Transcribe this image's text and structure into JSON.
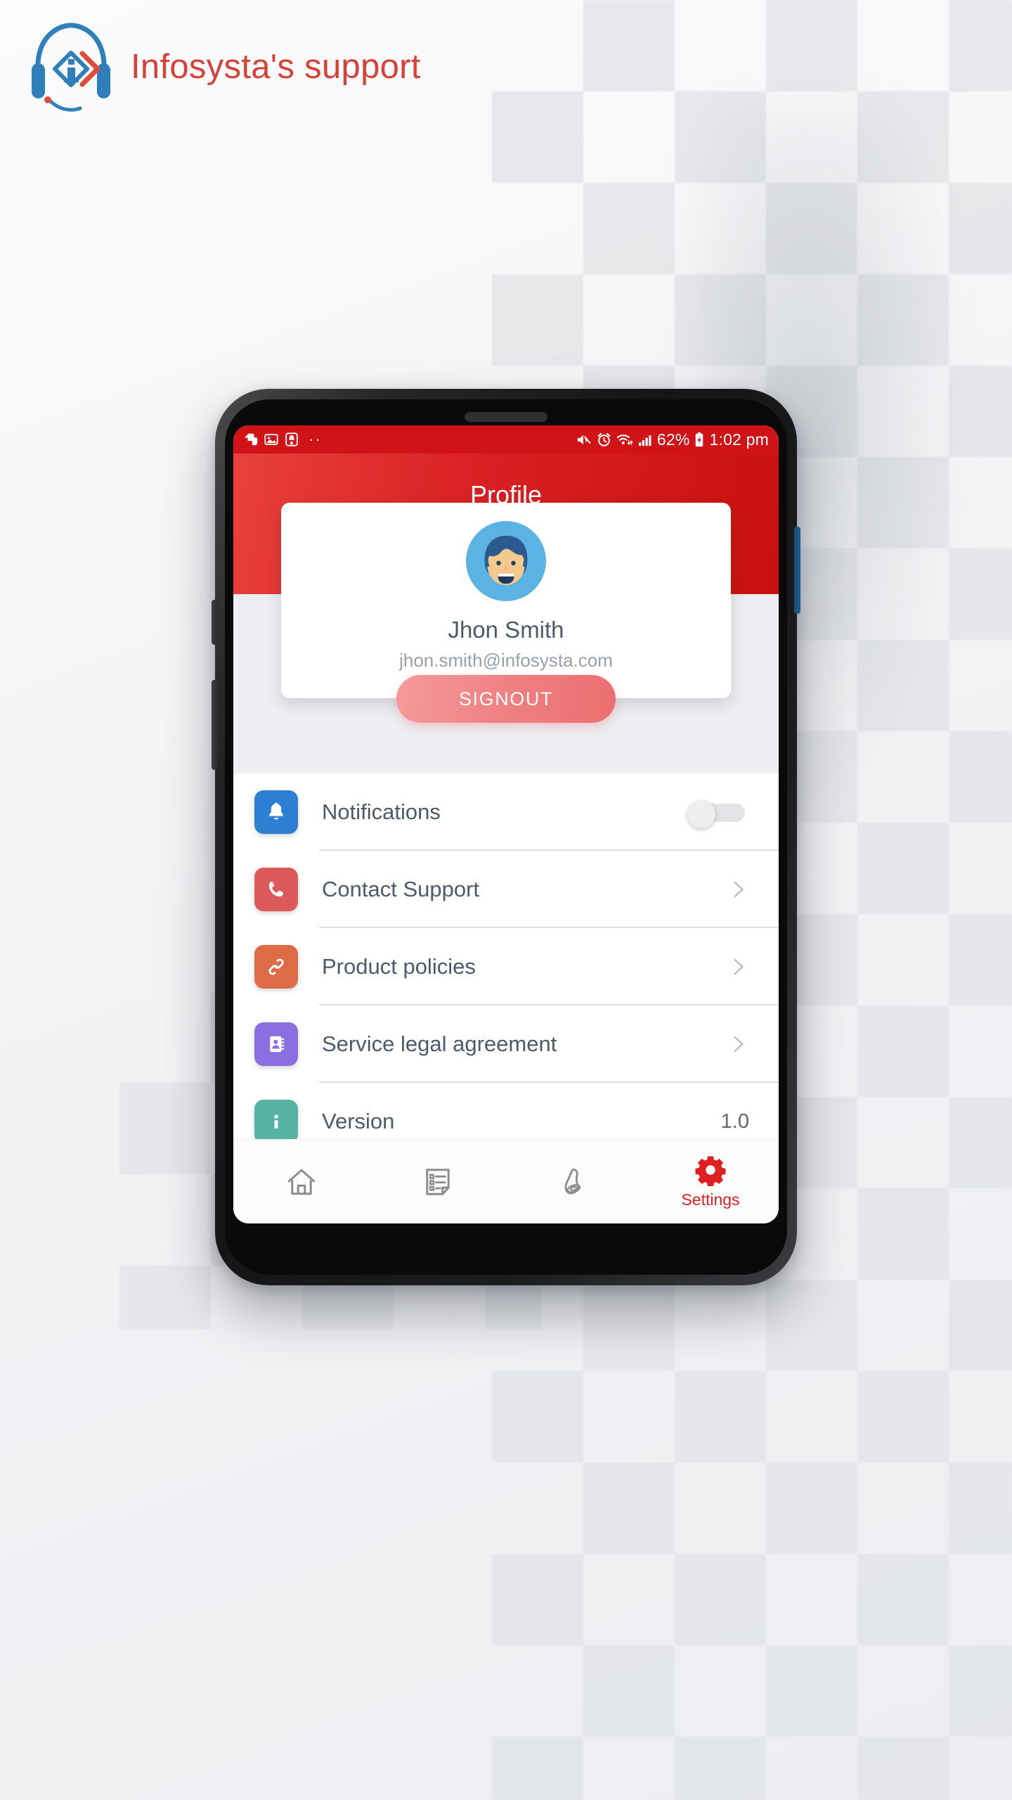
{
  "brand": {
    "name": "Infosysta's support",
    "logo_icon": "infosysta-headset-logo",
    "text_color": "#d84137",
    "mark_blue": "#2e7fba",
    "mark_red": "#e14b3c"
  },
  "phone": {
    "frame": "android-phone-mockup",
    "buttons": {
      "volume_up": "volume-up-button",
      "volume_down": "volume-down-button",
      "power": "power-button"
    }
  },
  "statusbar": {
    "left_icons": [
      "evernote-icon",
      "gallery-image-icon",
      "alarm-notification-icon"
    ],
    "overflow_dots": "··",
    "right_icons": [
      "mute-icon",
      "alarm-icon",
      "wifi-icon",
      "signal-bars-icon",
      "charging-battery-icon"
    ],
    "battery_percent": "62%",
    "clock": "1:02 pm",
    "background": "#cf1317"
  },
  "appbar": {
    "title": "Profile",
    "background_start": "#e8413c",
    "background_end": "#c8120f"
  },
  "profile": {
    "avatar_icon": "user-avatar-illustration",
    "name": "Jhon Smith",
    "email": "jhon.smith@infosysta.com",
    "signout_label": "SIGNOUT",
    "signout_color": "#ec6e70"
  },
  "settings": {
    "rows": [
      {
        "label": "Notifications",
        "icon": "bell-icon",
        "icon_color": "#2d7fd3",
        "control": "toggle",
        "toggle_on": false,
        "value": ""
      },
      {
        "label": "Contact Support",
        "icon": "phone-icon",
        "icon_color": "#dd5a5a",
        "control": "chevron",
        "value": ""
      },
      {
        "label": "Product policies",
        "icon": "link-chain-icon",
        "icon_color": "#dd6b45",
        "control": "chevron",
        "value": ""
      },
      {
        "label": "Service legal agreement",
        "icon": "contact-card-icon",
        "icon_color": "#8b6fe0",
        "control": "chevron",
        "value": ""
      },
      {
        "label": "Version",
        "icon": "info-icon",
        "icon_color": "#56b3a4",
        "control": "value",
        "value": "1.0"
      }
    ]
  },
  "bottom_nav": {
    "items": [
      {
        "label": "",
        "icon": "home-icon",
        "active": false
      },
      {
        "label": "",
        "icon": "list-document-icon",
        "active": false
      },
      {
        "label": "",
        "icon": "bell-outline-icon",
        "active": false
      },
      {
        "label": "Settings",
        "icon": "gear-icon",
        "active": true
      }
    ],
    "active_color": "#e02020",
    "inactive_color": "#8d8d8d"
  }
}
